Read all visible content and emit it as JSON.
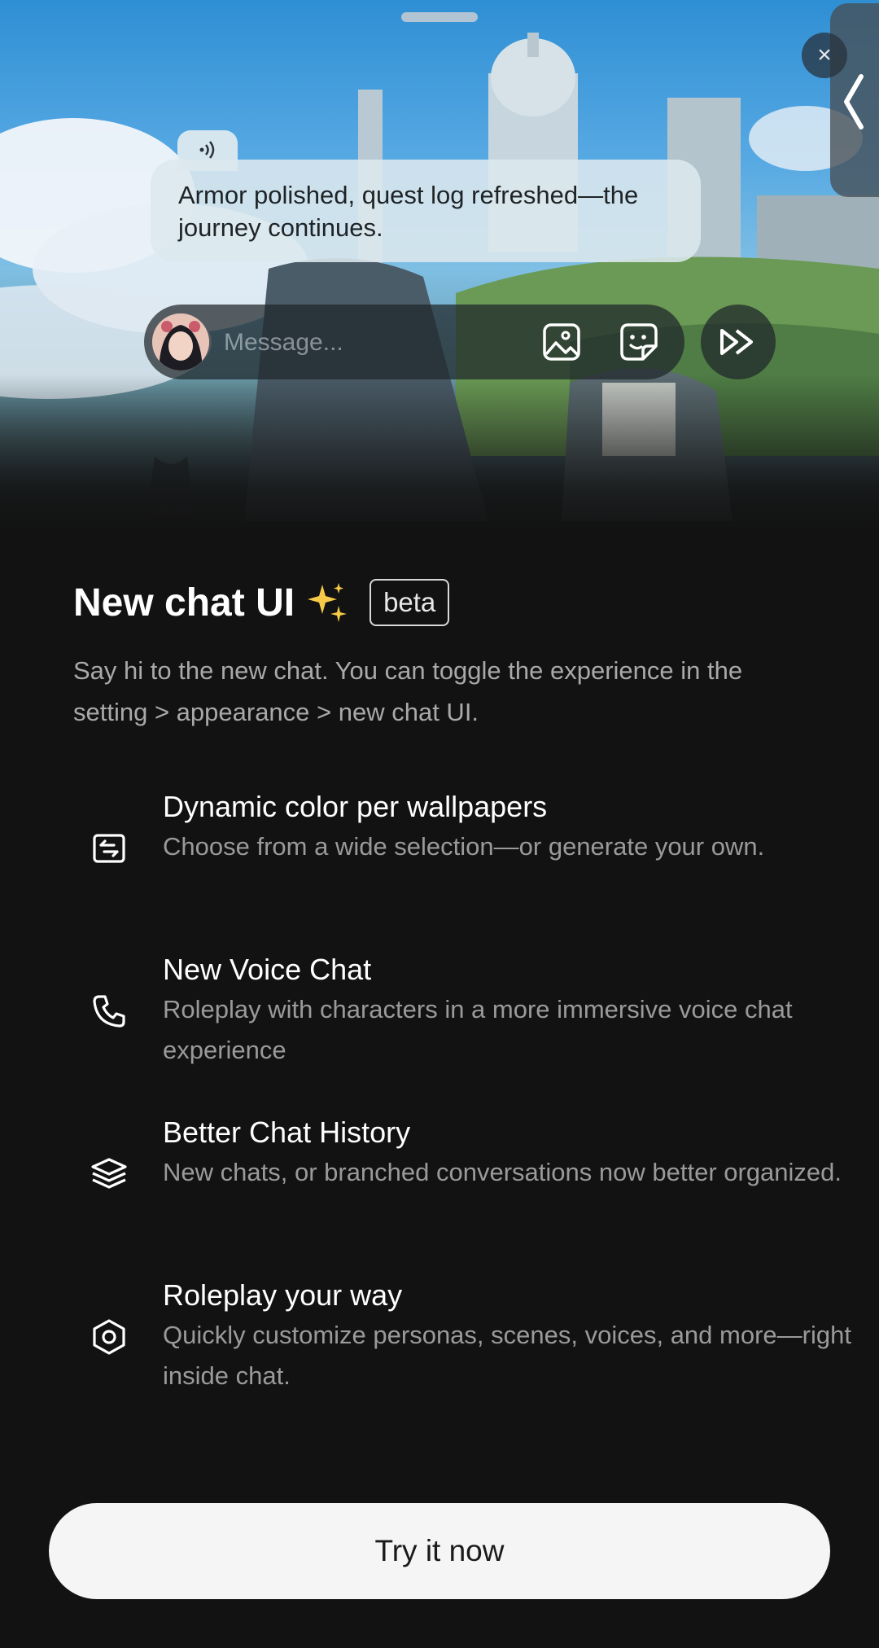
{
  "hero": {
    "bubble_text": "Armor polished, quest log refreshed—the journey continues.",
    "composer_placeholder": "Message...",
    "close_glyph": "×",
    "icons": [
      "voice-wave-icon",
      "image-icon",
      "sticker-icon",
      "fast-forward-icon",
      "chevron-left-icon"
    ]
  },
  "sheet": {
    "title": "New chat UI",
    "badge": "beta",
    "subtitle": "Say hi to the new chat. You can toggle the experience in the setting > appearance > new chat UI.",
    "features": [
      {
        "icon": "wallpaper-icon",
        "title": "Dynamic color per wallpapers",
        "desc": "Choose from a wide selection—or generate your own."
      },
      {
        "icon": "phone-icon",
        "title": "New Voice Chat",
        "desc": "Roleplay with characters in a more immersive voice chat experience"
      },
      {
        "icon": "layers-icon",
        "title": "Better Chat History",
        "desc": "New chats, or branched conversations now better organized."
      },
      {
        "icon": "hexagon-icon",
        "title": "Roleplay your way",
        "desc": "Quickly customize personas, scenes, voices, and more—right inside chat."
      }
    ],
    "cta_label": "Try it now"
  },
  "colors": {
    "background": "#121212",
    "cta_background": "#f5f5f5",
    "bubble": "#dce8ee"
  }
}
